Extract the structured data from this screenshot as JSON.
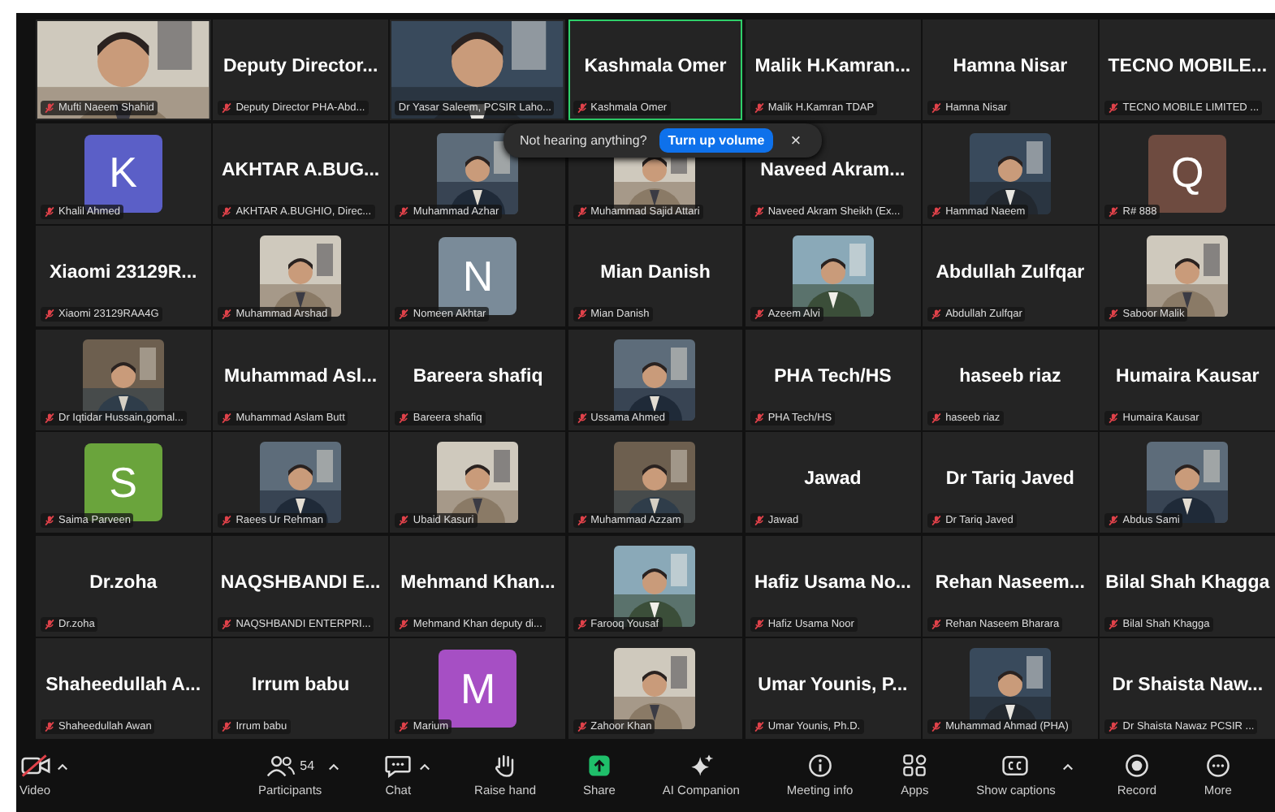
{
  "tiles": [
    {
      "kind": "video",
      "wide": true,
      "label": "Mufti Naeem Shahid",
      "muted": true,
      "active": false
    },
    {
      "kind": "name",
      "name": "Deputy Director...",
      "label": "Deputy Director PHA-Abd...",
      "muted": true,
      "active": false
    },
    {
      "kind": "video",
      "wide": true,
      "label": "Dr Yasar Saleem, PCSIR Laho...",
      "muted": false,
      "active": false
    },
    {
      "kind": "name",
      "name": "Kashmala Omer",
      "label": "Kashmala Omer",
      "muted": true,
      "active": true
    },
    {
      "kind": "name",
      "name": "Malik H.Kamran...",
      "label": "Malik H.Kamran TDAP",
      "muted": true,
      "active": false
    },
    {
      "kind": "name",
      "name": "Hamna Nisar",
      "label": "Hamna Nisar",
      "muted": true,
      "active": false
    },
    {
      "kind": "name",
      "name": "TECNO MOBILE...",
      "label": "TECNO MOBILE LIMITED ...",
      "muted": true,
      "active": false
    },
    {
      "kind": "avatar",
      "letter": "K",
      "color": "#5b5fc7",
      "label": "Khalil Ahmed",
      "muted": true,
      "active": false
    },
    {
      "kind": "name",
      "name": "AKHTAR A.BUG...",
      "label": "AKHTAR A.BUGHIO, Direc...",
      "muted": true,
      "active": false
    },
    {
      "kind": "video",
      "wide": false,
      "label": "Muhammad Azhar",
      "muted": true,
      "active": false
    },
    {
      "kind": "video",
      "wide": false,
      "label": "Muhammad Sajid Attari",
      "muted": true,
      "active": false
    },
    {
      "kind": "name",
      "name": "Naveed Akram...",
      "label": "Naveed Akram Sheikh (Ex...",
      "muted": true,
      "active": false
    },
    {
      "kind": "video",
      "wide": false,
      "label": "Hammad Naeem",
      "muted": true,
      "active": false
    },
    {
      "kind": "avatar",
      "letter": "Q",
      "color": "#6e4b40",
      "label": "R# 888",
      "muted": true,
      "active": false
    },
    {
      "kind": "name",
      "name": "Xiaomi 23129R...",
      "label": "Xiaomi 23129RAA4G",
      "muted": true,
      "active": false
    },
    {
      "kind": "video",
      "wide": false,
      "label": "Muhammad Arshad",
      "muted": true,
      "active": false
    },
    {
      "kind": "avatar",
      "letter": "N",
      "color": "#7a8b99",
      "label": "Nomeen Akhtar",
      "muted": true,
      "active": false
    },
    {
      "kind": "name",
      "name": "Mian Danish",
      "label": "Mian Danish",
      "muted": true,
      "active": false
    },
    {
      "kind": "video",
      "wide": false,
      "label": "Azeem Alvi",
      "muted": true,
      "active": false
    },
    {
      "kind": "name",
      "name": "Abdullah Zulfqar",
      "label": "Abdullah Zulfqar",
      "muted": true,
      "active": false
    },
    {
      "kind": "video",
      "wide": false,
      "label": "Saboor Malik",
      "muted": true,
      "active": false
    },
    {
      "kind": "video",
      "wide": false,
      "label": "Dr Iqtidar Hussain,gomal...",
      "muted": true,
      "active": false
    },
    {
      "kind": "name",
      "name": "Muhammad Asl...",
      "label": "Muhammad Aslam Butt",
      "muted": true,
      "active": false
    },
    {
      "kind": "name",
      "name": "Bareera shafiq",
      "label": "Bareera shafiq",
      "muted": true,
      "active": false
    },
    {
      "kind": "video",
      "wide": false,
      "label": "Ussama Ahmed",
      "muted": true,
      "active": false
    },
    {
      "kind": "name",
      "name": "PHA Tech/HS",
      "label": "PHA Tech/HS",
      "muted": true,
      "active": false
    },
    {
      "kind": "name",
      "name": "haseeb riaz",
      "label": "haseeb riaz",
      "muted": true,
      "active": false
    },
    {
      "kind": "name",
      "name": "Humaira Kausar",
      "label": "Humaira Kausar",
      "muted": true,
      "active": false
    },
    {
      "kind": "avatar",
      "letter": "S",
      "color": "#6aa43c",
      "label": "Saima Parveen",
      "muted": true,
      "active": false
    },
    {
      "kind": "video",
      "wide": false,
      "label": "Raees Ur Rehman",
      "muted": true,
      "active": false
    },
    {
      "kind": "video",
      "wide": false,
      "label": "Ubaid Kasuri",
      "muted": true,
      "active": false
    },
    {
      "kind": "video",
      "wide": false,
      "label": "Muhammad Azzam",
      "muted": true,
      "active": false
    },
    {
      "kind": "name",
      "name": "Jawad",
      "label": "Jawad",
      "muted": true,
      "active": false
    },
    {
      "kind": "name",
      "name": "Dr Tariq Javed",
      "label": "Dr Tariq Javed",
      "muted": true,
      "active": false
    },
    {
      "kind": "video",
      "wide": false,
      "label": "Abdus Sami",
      "muted": true,
      "active": false
    },
    {
      "kind": "name",
      "name": "Dr.zoha",
      "label": "Dr.zoha",
      "muted": true,
      "active": false
    },
    {
      "kind": "name",
      "name": "NAQSHBANDI E...",
      "label": "NAQSHBANDI ENTERPRI...",
      "muted": true,
      "active": false
    },
    {
      "kind": "name",
      "name": "Mehmand Khan...",
      "label": "Mehmand Khan deputy di...",
      "muted": true,
      "active": false
    },
    {
      "kind": "video",
      "wide": false,
      "label": "Farooq Yousaf",
      "muted": true,
      "active": false
    },
    {
      "kind": "name",
      "name": "Hafiz Usama No...",
      "label": "Hafiz Usama Noor",
      "muted": true,
      "active": false
    },
    {
      "kind": "name",
      "name": "Rehan Naseem...",
      "label": "Rehan Naseem Bharara",
      "muted": true,
      "active": false
    },
    {
      "kind": "name",
      "name": "Bilal Shah Khagga",
      "label": "Bilal Shah Khagga",
      "muted": true,
      "active": false
    },
    {
      "kind": "name",
      "name": "Shaheedullah A...",
      "label": "Shaheedullah Awan",
      "muted": true,
      "active": false
    },
    {
      "kind": "name",
      "name": "Irrum babu",
      "label": "Irrum babu",
      "muted": true,
      "active": false
    },
    {
      "kind": "avatar",
      "letter": "M",
      "color": "#a64fc4",
      "label": "Marium",
      "muted": true,
      "active": false
    },
    {
      "kind": "video",
      "wide": false,
      "label": "Zahoor Khan",
      "muted": true,
      "active": false
    },
    {
      "kind": "name",
      "name": "Umar Younis, P...",
      "label": "Umar Younis, Ph.D.",
      "muted": true,
      "active": false
    },
    {
      "kind": "video",
      "wide": false,
      "label": "Muhammad Ahmad (PHA)",
      "muted": true,
      "active": false
    },
    {
      "kind": "name",
      "name": "Dr Shaista Naw...",
      "label": "Dr Shaista Nawaz PCSIR ...",
      "muted": true,
      "active": false
    }
  ],
  "toast": {
    "text": "Not hearing anything?",
    "button": "Turn up volume",
    "close": "×"
  },
  "toolbar": [
    {
      "kind": "video",
      "label": "Video",
      "caret": true
    },
    {
      "kind": "participants",
      "label": "Participants",
      "count": "54",
      "caret": true
    },
    {
      "kind": "chat",
      "label": "Chat",
      "caret": true
    },
    {
      "kind": "hand",
      "label": "Raise hand",
      "caret": false
    },
    {
      "kind": "share",
      "label": "Share",
      "caret": false
    },
    {
      "kind": "ai",
      "label": "AI Companion",
      "caret": false
    },
    {
      "kind": "info",
      "label": "Meeting info",
      "caret": false
    },
    {
      "kind": "apps",
      "label": "Apps",
      "caret": false
    },
    {
      "kind": "captions",
      "label": "Show captions",
      "caret": true
    },
    {
      "kind": "record",
      "label": "Record",
      "caret": false
    },
    {
      "kind": "more",
      "label": "More",
      "caret": false
    }
  ]
}
